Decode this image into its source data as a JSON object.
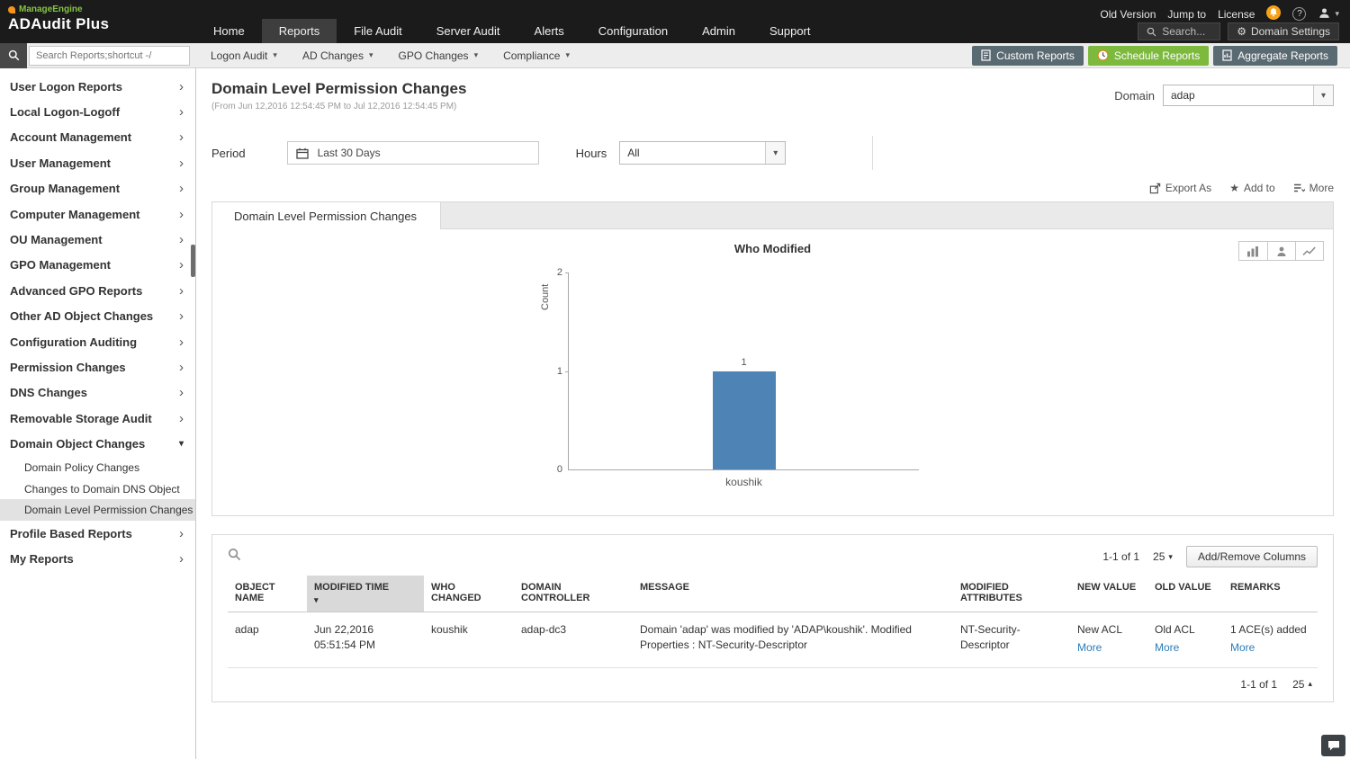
{
  "topbar": {
    "brand_company": "ManageEngine",
    "brand_product": "ADAudit Plus",
    "nav": [
      "Home",
      "Reports",
      "File Audit",
      "Server Audit",
      "Alerts",
      "Configuration",
      "Admin",
      "Support"
    ],
    "old_version": "Old Version",
    "jump_to": "Jump to",
    "license": "License",
    "help": "?",
    "search_placeholder": "Search...",
    "domain_settings": "Domain Settings"
  },
  "toolbar": {
    "report_search_placeholder": "Search Reports;shortcut -/",
    "menus": [
      "Logon Audit",
      "AD Changes",
      "GPO Changes",
      "Compliance"
    ],
    "custom_reports": "Custom Reports",
    "schedule_reports": "Schedule Reports",
    "aggregate_reports": "Aggregate Reports"
  },
  "sidebar": {
    "top": [
      "User Logon Reports",
      "Local Logon-Logoff",
      "Account Management",
      "User Management",
      "Group Management",
      "Computer Management",
      "OU Management",
      "GPO Management",
      "Advanced GPO Reports",
      "Other AD Object Changes",
      "Configuration Auditing",
      "Permission Changes",
      "DNS Changes",
      "Removable Storage Audit"
    ],
    "section": {
      "label": "Domain Object Changes",
      "children": [
        "Domain Policy Changes",
        "Changes to Domain DNS Object",
        "Domain Level Permission Changes"
      ]
    },
    "bottom": [
      "Profile Based Reports",
      "My Reports"
    ]
  },
  "report": {
    "title": "Domain Level Permission Changes",
    "date_range": "(From Jun 12,2016 12:54:45 PM to Jul 12,2016 12:54:45 PM)",
    "domain_label": "Domain",
    "domain_value": "adap",
    "period_label": "Period",
    "period_value": "Last 30 Days",
    "hours_label": "Hours",
    "hours_value": "All",
    "export_as": "Export As",
    "add_to": "Add to",
    "more": "More",
    "tab": "Domain Level Permission Changes"
  },
  "chart_data": {
    "type": "bar",
    "title": "Who Modified",
    "categories": [
      "koushik"
    ],
    "values": [
      1
    ],
    "xlabel": "",
    "ylabel": "Count",
    "ylim": [
      0,
      2
    ],
    "yticks": [
      2,
      1,
      0
    ],
    "bar_color": "#4d84b5",
    "grid": false,
    "legend": "none"
  },
  "table": {
    "pagination": "1-1 of 1",
    "page_size": "25",
    "add_remove_columns": "Add/Remove Columns",
    "headers": [
      "OBJECT NAME",
      "MODIFIED TIME",
      "WHO CHANGED",
      "DOMAIN CONTROLLER",
      "MESSAGE",
      "MODIFIED ATTRIBUTES",
      "NEW VALUE",
      "OLD VALUE",
      "REMARKS"
    ],
    "more_label": "More",
    "rows": [
      {
        "object_name": "adap",
        "modified_time": "Jun 22,2016 05:51:54 PM",
        "who_changed": "koushik",
        "domain_controller": "adap-dc3",
        "message": "Domain 'adap' was modified by 'ADAP\\koushik'. Modified Properties : NT-Security-Descriptor",
        "modified_attributes": "NT-Security-Descriptor",
        "new_value": "New ACL",
        "old_value": "Old ACL",
        "remarks": "1 ACE(s) added"
      }
    ],
    "pagination_bottom": "1-1 of 1",
    "page_size_bottom": "25"
  }
}
